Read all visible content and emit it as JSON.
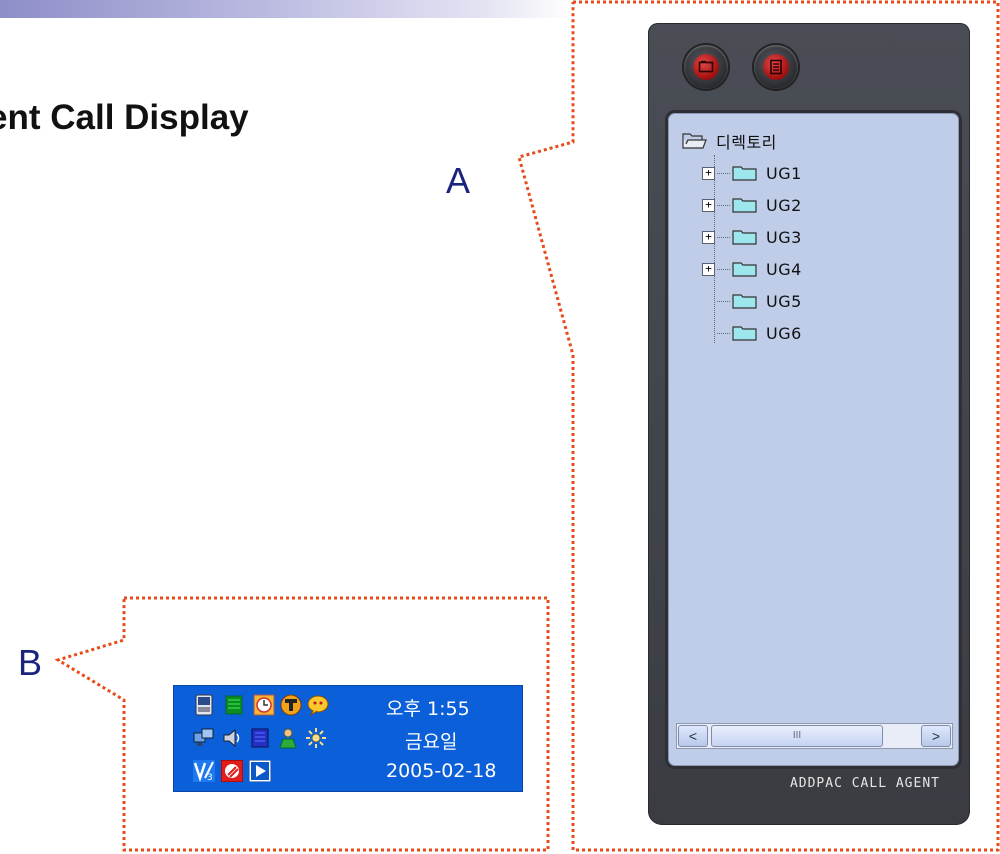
{
  "slide": {
    "title": "ent Call Display",
    "callout_a": "A",
    "callout_b": "B"
  },
  "agent_window": {
    "buttons": [
      {
        "icon": "folder-icon"
      },
      {
        "icon": "document-icon"
      }
    ],
    "tree": {
      "root": "디렉토리",
      "items": [
        {
          "label": "UG1",
          "expandable": true
        },
        {
          "label": "UG2",
          "expandable": true
        },
        {
          "label": "UG3",
          "expandable": true
        },
        {
          "label": "UG4",
          "expandable": true
        },
        {
          "label": "UG5",
          "expandable": false
        },
        {
          "label": "UG6",
          "expandable": false
        }
      ]
    },
    "scrollbar": {
      "left_arrow": "<",
      "right_arrow": ">",
      "thumb_grip": "III"
    },
    "footer": "ADDPAC CALL AGENT"
  },
  "tray": {
    "time": "오후 1:55",
    "day": "금요일",
    "date": "2005-02-18",
    "icons": [
      "pda-icon",
      "chip-icon",
      "clock-icon",
      "tool-icon",
      "chat-icon",
      "network-icon",
      "speaker-icon",
      "book-icon",
      "user-icon",
      "settings-icon",
      "v3-icon",
      "antivirus-icon",
      "play-icon"
    ]
  },
  "colors": {
    "callout_line": "#e84a1a",
    "letter": "#1a237e",
    "tray_bg": "#0b5fd8",
    "panel_bg": "#c0cde9"
  }
}
